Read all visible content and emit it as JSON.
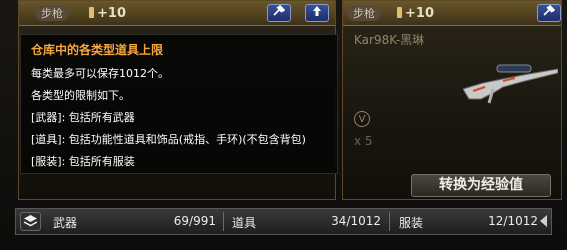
{
  "cards": [
    {
      "category_tag": "步枪",
      "level": "+10"
    },
    {
      "category_tag": "步枪",
      "level": "+10",
      "weapon_name": "Kar98K-黑琳",
      "sub_count": "x 5"
    }
  ],
  "exchange_button": {
    "label": "转换为经验值"
  },
  "tooltip": {
    "title": "仓库中的各类型道具上限",
    "lines": [
      "每类最多可以保存1012个。",
      "各类型的限制如下。",
      "[武器]: 包括所有武器",
      "[道具]: 包括功能性道具和饰品(戒指、手环)(不包含背包)",
      "[服装]: 包括所有服装"
    ]
  },
  "storage_bar": {
    "stats": [
      {
        "label": "武器",
        "value": "69/991"
      },
      {
        "label": "道具",
        "value": "34/1012"
      },
      {
        "label": "服装",
        "value": "12/1012"
      }
    ]
  },
  "icons": {
    "tools": "wrench-screwdriver-icon",
    "upgrade": "arrow-up-icon",
    "layers": "layers-icon",
    "scroll": "scroll-left-icon",
    "circle_v": "circle-v-icon"
  },
  "colors": {
    "tooltip_title": "#f5a73a",
    "accent_blue": "#2a3a82",
    "gold_border": "#8a6e2e"
  }
}
